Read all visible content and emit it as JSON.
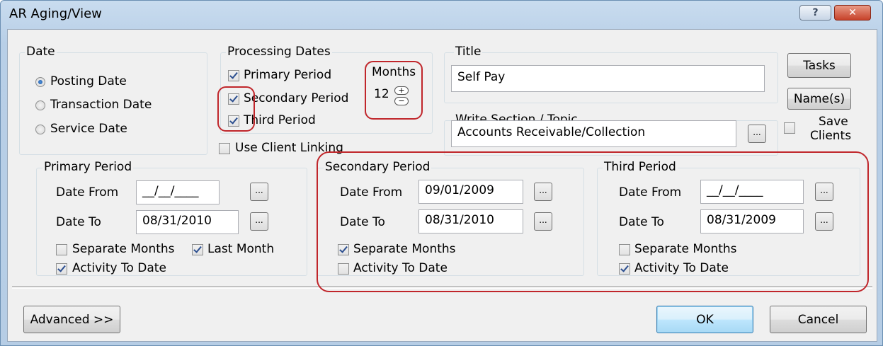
{
  "window": {
    "title": "AR Aging/View",
    "help_glyph": "?",
    "close_glyph": "✕"
  },
  "date_group": {
    "label": "Date",
    "options": [
      "Posting Date",
      "Transaction Date",
      "Service Date"
    ],
    "selected": "Posting Date"
  },
  "processing_dates": {
    "label": "Processing Dates",
    "primary": {
      "label": "Primary Period",
      "checked": true
    },
    "secondary": {
      "label": "Secondary Period",
      "checked": true
    },
    "third": {
      "label": "Third Period",
      "checked": true
    },
    "use_client_linking": {
      "label": "Use Client Linking",
      "checked": false
    }
  },
  "months": {
    "label": "Months",
    "value": "12",
    "plus": "+",
    "minus": "−"
  },
  "title_field": {
    "label": "Title",
    "value": "Self Pay"
  },
  "write_section": {
    "label": "Write Section / Topic",
    "value": "Accounts Receivable/Collection",
    "browse": "..."
  },
  "side_buttons": {
    "tasks": "Tasks",
    "names": "Name(s)",
    "save_clients": "Save\nClients",
    "save_line1": "Save",
    "save_line2": "Clients"
  },
  "primary_period": {
    "label": "Primary Period",
    "date_from_label": "Date From",
    "date_from": "__/__/____",
    "date_to_label": "Date To",
    "date_to": "08/31/2010",
    "separate_months": {
      "label": "Separate Months",
      "checked": false
    },
    "last_month": {
      "label": "Last Month",
      "checked": true
    },
    "activity_to_date": {
      "label": "Activity To Date",
      "checked": true
    }
  },
  "secondary_period": {
    "label": "Secondary Period",
    "date_from_label": "Date From",
    "date_from": "09/01/2009",
    "date_to_label": "Date To",
    "date_to": "08/31/2010",
    "separate_months": {
      "label": "Separate Months",
      "checked": true
    },
    "activity_to_date": {
      "label": "Activity To Date",
      "checked": false
    }
  },
  "third_period": {
    "label": "Third Period",
    "date_from_label": "Date From",
    "date_from": "__/__/____",
    "date_to_label": "Date To",
    "date_to": "08/31/2009",
    "separate_months": {
      "label": "Separate Months",
      "checked": false
    },
    "activity_to_date": {
      "label": "Activity To Date",
      "checked": true
    }
  },
  "footer": {
    "advanced": "Advanced >>",
    "ok": "OK",
    "cancel": "Cancel"
  },
  "colors": {
    "highlight": "#c0262b",
    "title_bar": "#b9d1ea",
    "dialog_bg": "#f0f0f0"
  }
}
